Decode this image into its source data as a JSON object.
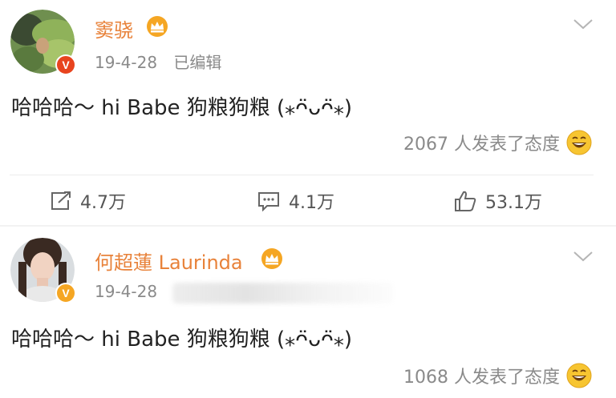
{
  "posts": [
    {
      "username": "窦骁",
      "date": "19-4-28",
      "edited": "已编辑",
      "content": "哈哈哈～ hi Babe 狗粮狗粮 (⁎ᴖ̈ᴗᴖ̈⁎)",
      "reactions": "2067 人发表了态度",
      "verified_color": "#e8441e",
      "actions": {
        "repost": "4.7万",
        "comment": "4.1万",
        "like": "53.1万"
      }
    },
    {
      "username": "何超蓮 Laurinda",
      "date": "19-4-28",
      "content": "哈哈哈～ hi Babe 狗粮狗粮 (⁎ᴖ̈ᴗᴖ̈⁎)",
      "reactions": "1068 人发表了态度",
      "verified_color": "#f5a623"
    }
  ],
  "icons": {
    "crown": "crown-icon",
    "verified": "verified-badge-icon",
    "chevron": "chevron-down-icon",
    "repost": "repost-icon",
    "comment": "comment-icon",
    "like": "thumbs-up-icon",
    "emoji": "laughing-emoji-icon"
  },
  "colors": {
    "username": "#e8823a",
    "meta": "#8a8a8a",
    "crown": "#f5a623"
  }
}
